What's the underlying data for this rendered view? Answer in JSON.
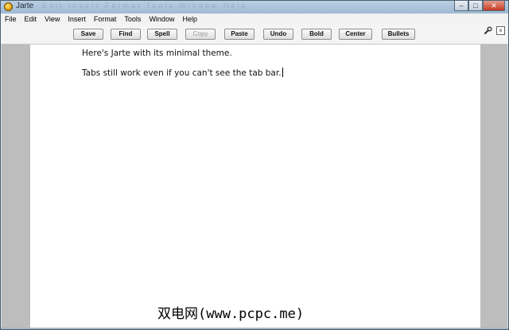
{
  "window": {
    "title": "Jarte",
    "ghost_title": "Edit  Insert  Format  Tools  Window  Help",
    "controls": {
      "minimize": "–",
      "maximize": "□",
      "close": "✕"
    }
  },
  "menubar": {
    "items": [
      {
        "label": "File"
      },
      {
        "label": "Edit"
      },
      {
        "label": "View"
      },
      {
        "label": "Insert"
      },
      {
        "label": "Format"
      },
      {
        "label": "Tools"
      },
      {
        "label": "Window"
      },
      {
        "label": "Help"
      }
    ]
  },
  "toolbar": {
    "buttons": [
      {
        "label": "Save",
        "enabled": true
      },
      {
        "label": "Find",
        "enabled": true
      },
      {
        "label": "Spell",
        "enabled": true
      },
      {
        "label": "Copy",
        "enabled": false
      },
      {
        "label": "Paste",
        "enabled": true
      },
      {
        "label": "Undo",
        "enabled": true
      },
      {
        "label": "Bold",
        "enabled": true
      },
      {
        "label": "Center",
        "enabled": true
      },
      {
        "label": "Bullets",
        "enabled": true
      }
    ],
    "icons": {
      "tools": "wrench-icon",
      "close_document": "close-icon"
    }
  },
  "document": {
    "paragraphs": [
      "Here's Jarte with its minimal theme.",
      "Tabs still work even if you can't see the tab bar."
    ]
  },
  "watermark": "双电网(www.pcpc.me)",
  "colors": {
    "titlebar": "#b9cfe3",
    "margin": "#bdbdbd",
    "page": "#ffffff"
  }
}
